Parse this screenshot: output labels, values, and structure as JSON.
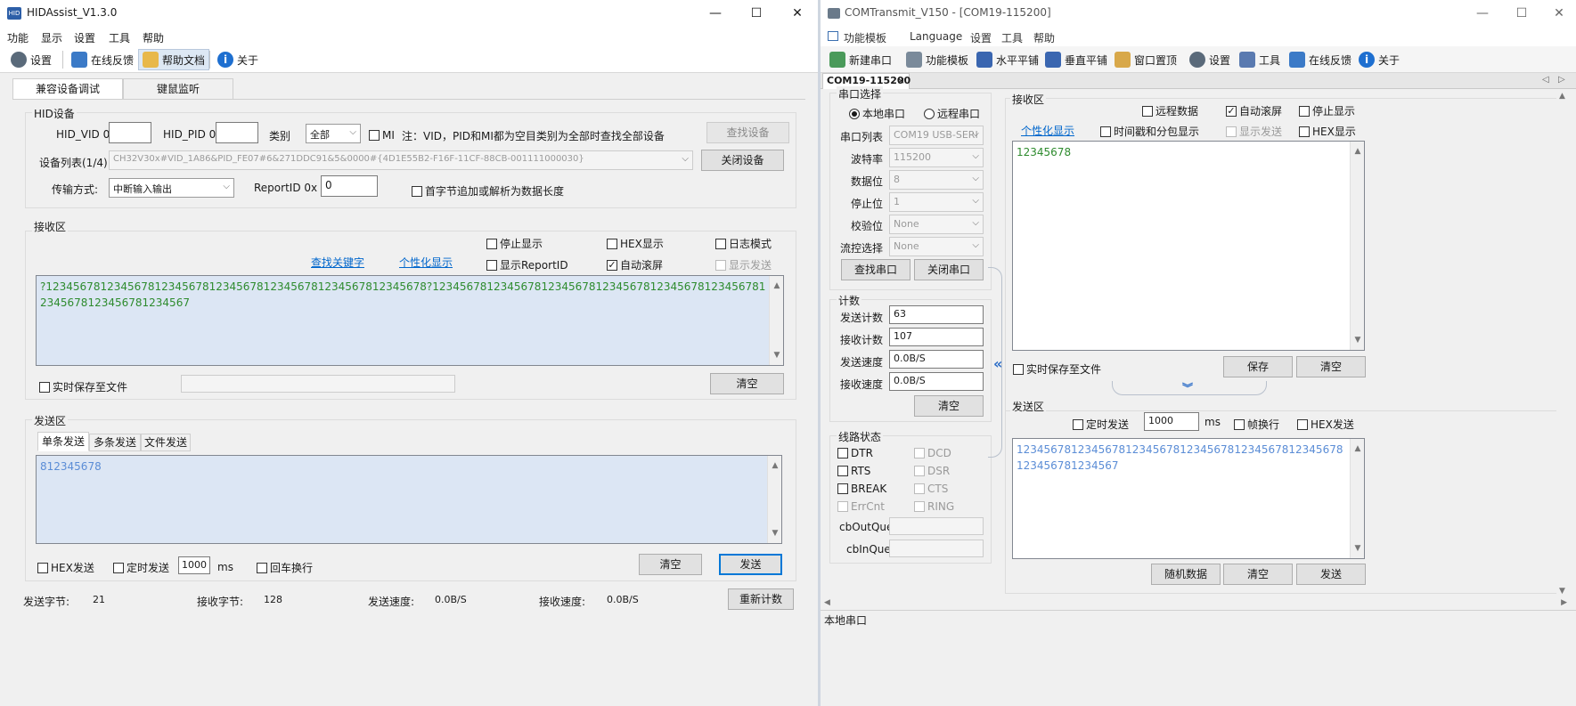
{
  "left": {
    "title": "HIDAssist_V1.3.0",
    "menu": [
      "功能",
      "显示",
      "设置",
      "工具",
      "帮助"
    ],
    "toolbar": {
      "settings": "设置",
      "feedback": "在线反馈",
      "help": "帮助文档",
      "about": "关于"
    },
    "tabs": [
      "兼容设备调试",
      "键鼠监听"
    ],
    "hid": {
      "group": "HID设备",
      "vid_label": "HID_VID 0x",
      "vid_value": "",
      "pid_label": "HID_PID 0x",
      "pid_value": "",
      "category_label": "类别",
      "category_value": "全部",
      "mi_label": "MI",
      "note": "注：VID，PID和MI都为空目类别为全部时查找全部设备",
      "find_button": "查找设备",
      "list_label": "设备列表(1/4):",
      "list_value": "CH32V30x#VID_1A86&PID_FE07#6&271DDC91&5&0000#{4D1E55B2-F16F-11CF-88CB-001111000030}",
      "close_button": "关闭设备",
      "transfer_label": "传输方式:",
      "transfer_value": "中断输入输出",
      "reportid_label": "ReportID 0x",
      "reportid_value": "0",
      "firstbyte_label": "首字节追加或解析为数据长度"
    },
    "recv": {
      "group": "接收区",
      "stop_display": "停止显示",
      "hex_display": "HEX显示",
      "log_mode": "日志模式",
      "find_keyword": "查找关键字",
      "personalize": "个性化显示",
      "show_reportid": "显示ReportID",
      "auto_scroll": "自动滚屏",
      "show_send": "显示发送",
      "content": "?12345678123456781234567812345678123456781234567812345678?12345678123456781234567812345678123456781234567812345678123456781234567",
      "save_realtime": "实时保存至文件",
      "clear": "清空"
    },
    "send": {
      "group": "发送区",
      "tabs": [
        "单条发送",
        "多条发送",
        "文件发送"
      ],
      "content": "812345678",
      "hex_send": "HEX发送",
      "timed_send": "定时发送",
      "interval": "1000",
      "ms": "ms",
      "crlf": "回车换行",
      "clear": "清空",
      "send": "发送"
    },
    "status": {
      "sent_label": "发送字节:",
      "sent_value": "21",
      "recv_label": "接收字节:",
      "recv_value": "128",
      "send_speed_label": "发送速度:",
      "send_speed_value": "0.0B/S",
      "recv_speed_label": "接收速度:",
      "recv_speed_value": "0.0B/S",
      "recount": "重新计数"
    }
  },
  "right": {
    "title": "COMTransmit_V150 - [COM19-115200]",
    "menu": [
      "功能模板",
      "Language",
      "设置",
      "工具",
      "帮助"
    ],
    "toolbar": [
      "新建串口",
      "功能模板",
      "水平平铺",
      "垂直平铺",
      "窗口置顶",
      "设置",
      "工具",
      "在线反馈",
      "关于"
    ],
    "doc_tab": "COM19-115200",
    "serial": {
      "group": "串口选择",
      "local": "本地串口",
      "remote": "远程串口",
      "fields": [
        {
          "label": "串口列表",
          "value": "COM19  USB-SERI"
        },
        {
          "label": "波特率",
          "value": "115200"
        },
        {
          "label": "数据位",
          "value": "8"
        },
        {
          "label": "停止位",
          "value": "1"
        },
        {
          "label": "校验位",
          "value": "None"
        },
        {
          "label": "流控选择",
          "value": "None"
        }
      ],
      "find": "查找串口",
      "close": "关闭串口"
    },
    "count": {
      "group": "计数",
      "rows": [
        {
          "label": "发送计数",
          "value": "63"
        },
        {
          "label": "接收计数",
          "value": "107"
        },
        {
          "label": "发送速度",
          "value": "0.0B/S"
        },
        {
          "label": "接收速度",
          "value": "0.0B/S"
        }
      ],
      "clear": "清空"
    },
    "line": {
      "group": "线路状态",
      "left": [
        "DTR",
        "RTS",
        "BREAK",
        "ErrCnt"
      ],
      "right": [
        "DCD",
        "DSR",
        "CTS",
        "RING"
      ],
      "out_label": "cbOutQue",
      "in_label": "cbInQue"
    },
    "recv": {
      "group": "接收区",
      "remote_data": "远程数据",
      "auto_scroll": "自动滚屏",
      "stop_display": "停止显示",
      "personalize": "个性化显示",
      "timestamp": "时间戳和分包显示",
      "show_send": "显示发送",
      "hex_display": "HEX显示",
      "content": "12345678",
      "save_realtime": "实时保存至文件",
      "save": "保存",
      "clear": "清空"
    },
    "send": {
      "group": "发送区",
      "timed": "定时发送",
      "interval": "1000",
      "ms": "ms",
      "frame_newline": "帧换行",
      "hex_send": "HEX发送",
      "content": "123456781234567812345678123456781234567812345678123456781234567",
      "random": "随机数据",
      "clear": "清空",
      "send": "发送"
    },
    "statusbar": "本地串口"
  },
  "colors": {
    "green_text": "#2e8b2e",
    "blue_text": "#5b8dd6",
    "recv_bg": "#dce6f4",
    "link": "#0066cc",
    "focus": "#0078d7"
  }
}
